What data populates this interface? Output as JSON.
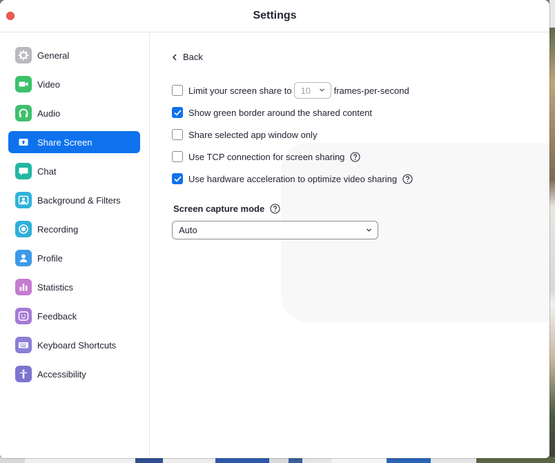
{
  "window": {
    "title": "Settings"
  },
  "sidebar": {
    "items": [
      {
        "label": "General",
        "icon": "gear-icon",
        "color": "#b9b9c0",
        "active": false
      },
      {
        "label": "Video",
        "icon": "video-camera-icon",
        "color": "#3cc16b",
        "active": false
      },
      {
        "label": "Audio",
        "icon": "headphones-icon",
        "color": "#3fbf6c",
        "active": false
      },
      {
        "label": "Share Screen",
        "icon": "share-screen-icon",
        "color": "#ffffff",
        "active": true
      },
      {
        "label": "Chat",
        "icon": "chat-bubble-icon",
        "color": "#22b7a4",
        "active": false
      },
      {
        "label": "Background & Filters",
        "icon": "background-person-icon",
        "color": "#2fb3d9",
        "active": false
      },
      {
        "label": "Recording",
        "icon": "record-icon",
        "color": "#2fb0d9",
        "active": false
      },
      {
        "label": "Profile",
        "icon": "profile-icon",
        "color": "#3d9ae8",
        "active": false
      },
      {
        "label": "Statistics",
        "icon": "bar-chart-icon",
        "color": "#c47bd1",
        "active": false
      },
      {
        "label": "Feedback",
        "icon": "smiley-icon",
        "color": "#a57ad8",
        "active": false
      },
      {
        "label": "Keyboard Shortcuts",
        "icon": "keyboard-icon",
        "color": "#8b7fd9",
        "active": false
      },
      {
        "label": "Accessibility",
        "icon": "accessibility-icon",
        "color": "#7c74cf",
        "active": false
      }
    ]
  },
  "content": {
    "back_label": "Back",
    "options": {
      "limit_fps": {
        "label": "Limit your screen share to",
        "checked": false,
        "fps_value": "10",
        "suffix": "frames-per-second"
      },
      "green_border": {
        "label": "Show green border around the shared content",
        "checked": true
      },
      "selected_window": {
        "label": "Share selected app window only",
        "checked": false
      },
      "tcp": {
        "label": "Use TCP connection for screen sharing",
        "checked": false
      },
      "hw_accel": {
        "label": "Use hardware acceleration to optimize video sharing",
        "checked": true
      }
    },
    "capture_mode": {
      "label": "Screen capture mode",
      "value": "Auto"
    }
  },
  "colors": {
    "accent": "#0e72ed",
    "close": "#ee5a52",
    "text": "#232333"
  }
}
